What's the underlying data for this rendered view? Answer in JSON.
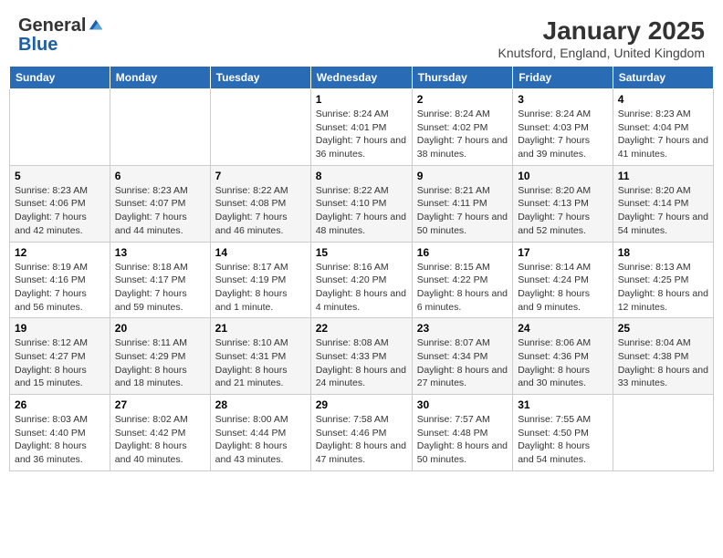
{
  "logo": {
    "general": "General",
    "blue": "Blue"
  },
  "header": {
    "month": "January 2025",
    "location": "Knutsford, England, United Kingdom"
  },
  "weekdays": [
    "Sunday",
    "Monday",
    "Tuesday",
    "Wednesday",
    "Thursday",
    "Friday",
    "Saturday"
  ],
  "weeks": [
    [
      {
        "day": "",
        "sunrise": "",
        "sunset": "",
        "daylight": ""
      },
      {
        "day": "",
        "sunrise": "",
        "sunset": "",
        "daylight": ""
      },
      {
        "day": "",
        "sunrise": "",
        "sunset": "",
        "daylight": ""
      },
      {
        "day": "1",
        "sunrise": "Sunrise: 8:24 AM",
        "sunset": "Sunset: 4:01 PM",
        "daylight": "Daylight: 7 hours and 36 minutes."
      },
      {
        "day": "2",
        "sunrise": "Sunrise: 8:24 AM",
        "sunset": "Sunset: 4:02 PM",
        "daylight": "Daylight: 7 hours and 38 minutes."
      },
      {
        "day": "3",
        "sunrise": "Sunrise: 8:24 AM",
        "sunset": "Sunset: 4:03 PM",
        "daylight": "Daylight: 7 hours and 39 minutes."
      },
      {
        "day": "4",
        "sunrise": "Sunrise: 8:23 AM",
        "sunset": "Sunset: 4:04 PM",
        "daylight": "Daylight: 7 hours and 41 minutes."
      }
    ],
    [
      {
        "day": "5",
        "sunrise": "Sunrise: 8:23 AM",
        "sunset": "Sunset: 4:06 PM",
        "daylight": "Daylight: 7 hours and 42 minutes."
      },
      {
        "day": "6",
        "sunrise": "Sunrise: 8:23 AM",
        "sunset": "Sunset: 4:07 PM",
        "daylight": "Daylight: 7 hours and 44 minutes."
      },
      {
        "day": "7",
        "sunrise": "Sunrise: 8:22 AM",
        "sunset": "Sunset: 4:08 PM",
        "daylight": "Daylight: 7 hours and 46 minutes."
      },
      {
        "day": "8",
        "sunrise": "Sunrise: 8:22 AM",
        "sunset": "Sunset: 4:10 PM",
        "daylight": "Daylight: 7 hours and 48 minutes."
      },
      {
        "day": "9",
        "sunrise": "Sunrise: 8:21 AM",
        "sunset": "Sunset: 4:11 PM",
        "daylight": "Daylight: 7 hours and 50 minutes."
      },
      {
        "day": "10",
        "sunrise": "Sunrise: 8:20 AM",
        "sunset": "Sunset: 4:13 PM",
        "daylight": "Daylight: 7 hours and 52 minutes."
      },
      {
        "day": "11",
        "sunrise": "Sunrise: 8:20 AM",
        "sunset": "Sunset: 4:14 PM",
        "daylight": "Daylight: 7 hours and 54 minutes."
      }
    ],
    [
      {
        "day": "12",
        "sunrise": "Sunrise: 8:19 AM",
        "sunset": "Sunset: 4:16 PM",
        "daylight": "Daylight: 7 hours and 56 minutes."
      },
      {
        "day": "13",
        "sunrise": "Sunrise: 8:18 AM",
        "sunset": "Sunset: 4:17 PM",
        "daylight": "Daylight: 7 hours and 59 minutes."
      },
      {
        "day": "14",
        "sunrise": "Sunrise: 8:17 AM",
        "sunset": "Sunset: 4:19 PM",
        "daylight": "Daylight: 8 hours and 1 minute."
      },
      {
        "day": "15",
        "sunrise": "Sunrise: 8:16 AM",
        "sunset": "Sunset: 4:20 PM",
        "daylight": "Daylight: 8 hours and 4 minutes."
      },
      {
        "day": "16",
        "sunrise": "Sunrise: 8:15 AM",
        "sunset": "Sunset: 4:22 PM",
        "daylight": "Daylight: 8 hours and 6 minutes."
      },
      {
        "day": "17",
        "sunrise": "Sunrise: 8:14 AM",
        "sunset": "Sunset: 4:24 PM",
        "daylight": "Daylight: 8 hours and 9 minutes."
      },
      {
        "day": "18",
        "sunrise": "Sunrise: 8:13 AM",
        "sunset": "Sunset: 4:25 PM",
        "daylight": "Daylight: 8 hours and 12 minutes."
      }
    ],
    [
      {
        "day": "19",
        "sunrise": "Sunrise: 8:12 AM",
        "sunset": "Sunset: 4:27 PM",
        "daylight": "Daylight: 8 hours and 15 minutes."
      },
      {
        "day": "20",
        "sunrise": "Sunrise: 8:11 AM",
        "sunset": "Sunset: 4:29 PM",
        "daylight": "Daylight: 8 hours and 18 minutes."
      },
      {
        "day": "21",
        "sunrise": "Sunrise: 8:10 AM",
        "sunset": "Sunset: 4:31 PM",
        "daylight": "Daylight: 8 hours and 21 minutes."
      },
      {
        "day": "22",
        "sunrise": "Sunrise: 8:08 AM",
        "sunset": "Sunset: 4:33 PM",
        "daylight": "Daylight: 8 hours and 24 minutes."
      },
      {
        "day": "23",
        "sunrise": "Sunrise: 8:07 AM",
        "sunset": "Sunset: 4:34 PM",
        "daylight": "Daylight: 8 hours and 27 minutes."
      },
      {
        "day": "24",
        "sunrise": "Sunrise: 8:06 AM",
        "sunset": "Sunset: 4:36 PM",
        "daylight": "Daylight: 8 hours and 30 minutes."
      },
      {
        "day": "25",
        "sunrise": "Sunrise: 8:04 AM",
        "sunset": "Sunset: 4:38 PM",
        "daylight": "Daylight: 8 hours and 33 minutes."
      }
    ],
    [
      {
        "day": "26",
        "sunrise": "Sunrise: 8:03 AM",
        "sunset": "Sunset: 4:40 PM",
        "daylight": "Daylight: 8 hours and 36 minutes."
      },
      {
        "day": "27",
        "sunrise": "Sunrise: 8:02 AM",
        "sunset": "Sunset: 4:42 PM",
        "daylight": "Daylight: 8 hours and 40 minutes."
      },
      {
        "day": "28",
        "sunrise": "Sunrise: 8:00 AM",
        "sunset": "Sunset: 4:44 PM",
        "daylight": "Daylight: 8 hours and 43 minutes."
      },
      {
        "day": "29",
        "sunrise": "Sunrise: 7:58 AM",
        "sunset": "Sunset: 4:46 PM",
        "daylight": "Daylight: 8 hours and 47 minutes."
      },
      {
        "day": "30",
        "sunrise": "Sunrise: 7:57 AM",
        "sunset": "Sunset: 4:48 PM",
        "daylight": "Daylight: 8 hours and 50 minutes."
      },
      {
        "day": "31",
        "sunrise": "Sunrise: 7:55 AM",
        "sunset": "Sunset: 4:50 PM",
        "daylight": "Daylight: 8 hours and 54 minutes."
      },
      {
        "day": "",
        "sunrise": "",
        "sunset": "",
        "daylight": ""
      }
    ]
  ]
}
